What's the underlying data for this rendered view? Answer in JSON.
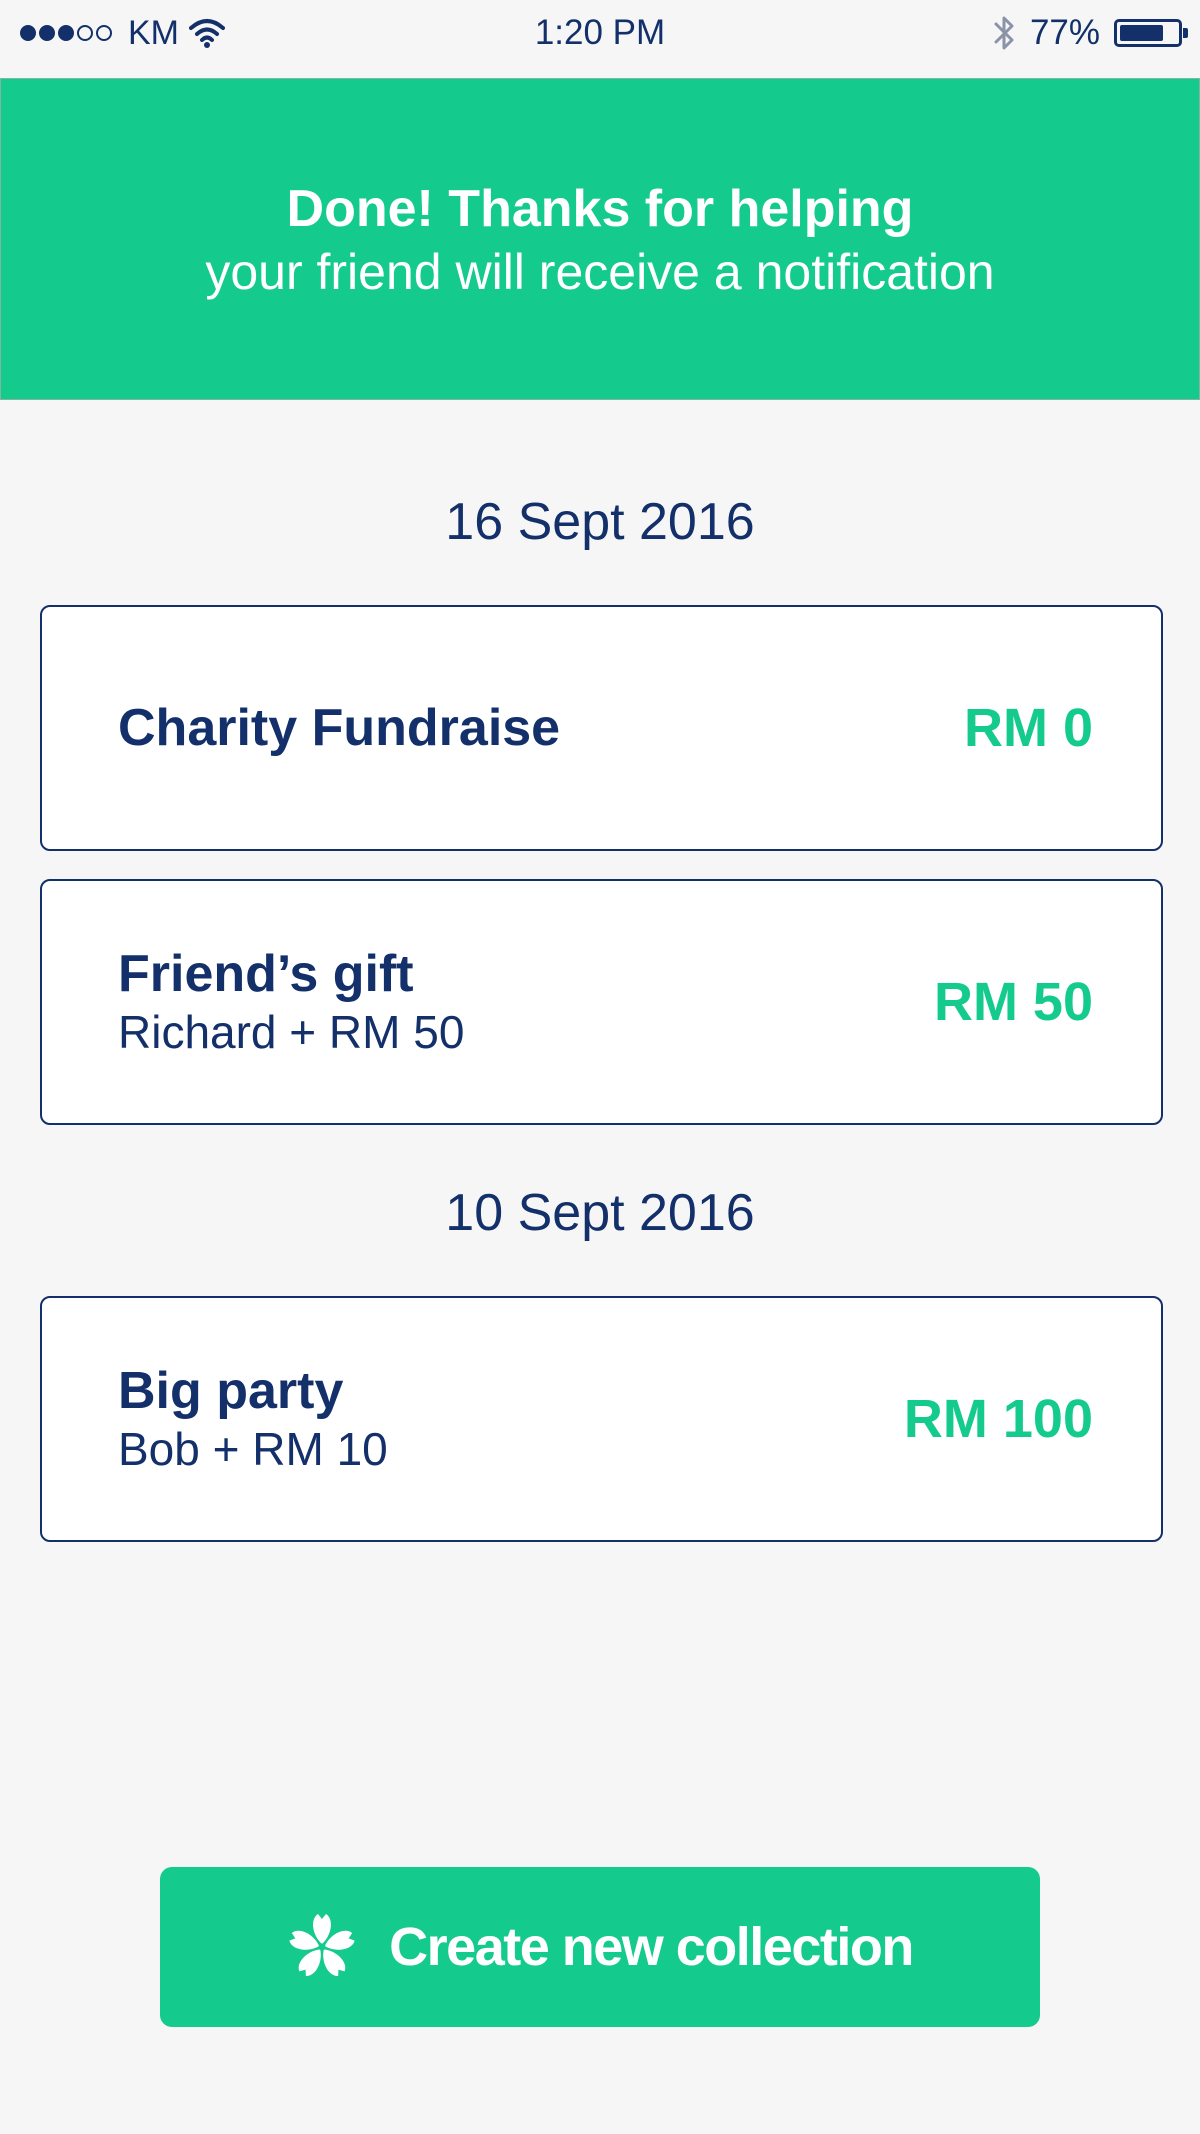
{
  "status_bar": {
    "signal_dots_filled": 3,
    "signal_dots_total": 5,
    "carrier": "KM",
    "time": "1:20 PM",
    "battery_percent_label": "77%",
    "battery_level": 0.77,
    "icons": [
      "wifi-icon",
      "bluetooth-icon",
      "battery-icon"
    ]
  },
  "banner": {
    "title": "Done! Thanks for helping",
    "subtitle": "your friend will receive a notification",
    "background_color": "#14cb8d"
  },
  "groups": [
    {
      "date": "16 Sept 2016",
      "items": [
        {
          "title": "Charity Fundraise",
          "subtitle": "",
          "amount": "RM 0"
        },
        {
          "title": "Friend’s gift",
          "subtitle": "Richard + RM 50",
          "amount": "RM 50"
        }
      ]
    },
    {
      "date": "10 Sept 2016",
      "items": [
        {
          "title": "Big party",
          "subtitle": "Bob + RM 10",
          "amount": "RM 100"
        }
      ]
    }
  ],
  "create_button": {
    "label": "Create new collection",
    "icon": "flower-icon"
  },
  "colors": {
    "accent": "#14cb8d",
    "text_primary": "#13306a",
    "background": "#f6f6f6"
  }
}
